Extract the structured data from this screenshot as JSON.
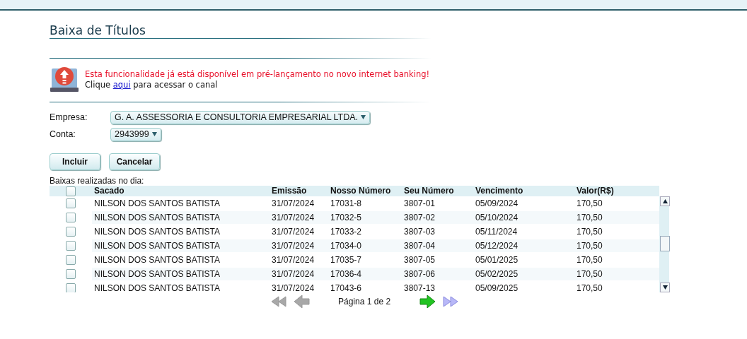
{
  "title": "Baixa de Títulos",
  "notice": {
    "message": "Esta funcionalidade já está disponível em pré-lançamento no novo internet banking!",
    "before_link": "Clique",
    "link": "aqui",
    "after_link": "para acessar o canal"
  },
  "fields": [
    {
      "label": "Empresa:",
      "value": "G. A. ASSESSORIA E CONSULTORIA EMPRESARIAL LTDA."
    },
    {
      "label": "Conta:",
      "value": "2943999"
    }
  ],
  "buttons": [
    "Incluir",
    "Cancelar"
  ],
  "table": {
    "caption": "Baixas realizadas no dia:",
    "all_checked": false,
    "columns": [
      "Sacado",
      "Emissão",
      "Nosso Número",
      "Seu Número",
      "Vencimento",
      "Valor(R$)"
    ],
    "rows": [
      {
        "checked": false,
        "cells": [
          "NILSON DOS SANTOS BATISTA",
          "31/07/2024",
          "17031-8",
          "3807-01",
          "05/09/2024",
          "170,50"
        ]
      },
      {
        "checked": false,
        "cells": [
          "NILSON DOS SANTOS BATISTA",
          "31/07/2024",
          "17032-5",
          "3807-02",
          "05/10/2024",
          "170,50"
        ]
      },
      {
        "checked": false,
        "cells": [
          "NILSON DOS SANTOS BATISTA",
          "31/07/2024",
          "17033-2",
          "3807-03",
          "05/11/2024",
          "170,50"
        ]
      },
      {
        "checked": false,
        "cells": [
          "NILSON DOS SANTOS BATISTA",
          "31/07/2024",
          "17034-0",
          "3807-04",
          "05/12/2024",
          "170,50"
        ]
      },
      {
        "checked": false,
        "cells": [
          "NILSON DOS SANTOS BATISTA",
          "31/07/2024",
          "17035-7",
          "3807-05",
          "05/01/2025",
          "170,50"
        ]
      },
      {
        "checked": false,
        "cells": [
          "NILSON DOS SANTOS BATISTA",
          "31/07/2024",
          "17036-4",
          "3807-06",
          "05/02/2025",
          "170,50"
        ]
      },
      {
        "checked": false,
        "cells": [
          "NILSON DOS SANTOS BATISTA",
          "31/07/2024",
          "17043-6",
          "3807-13",
          "05/09/2025",
          "170,50"
        ]
      }
    ]
  },
  "pagination": {
    "text": "Página 1 de 2",
    "first_disabled": true,
    "prev_disabled": true,
    "next_disabled": false,
    "last_disabled": false
  }
}
